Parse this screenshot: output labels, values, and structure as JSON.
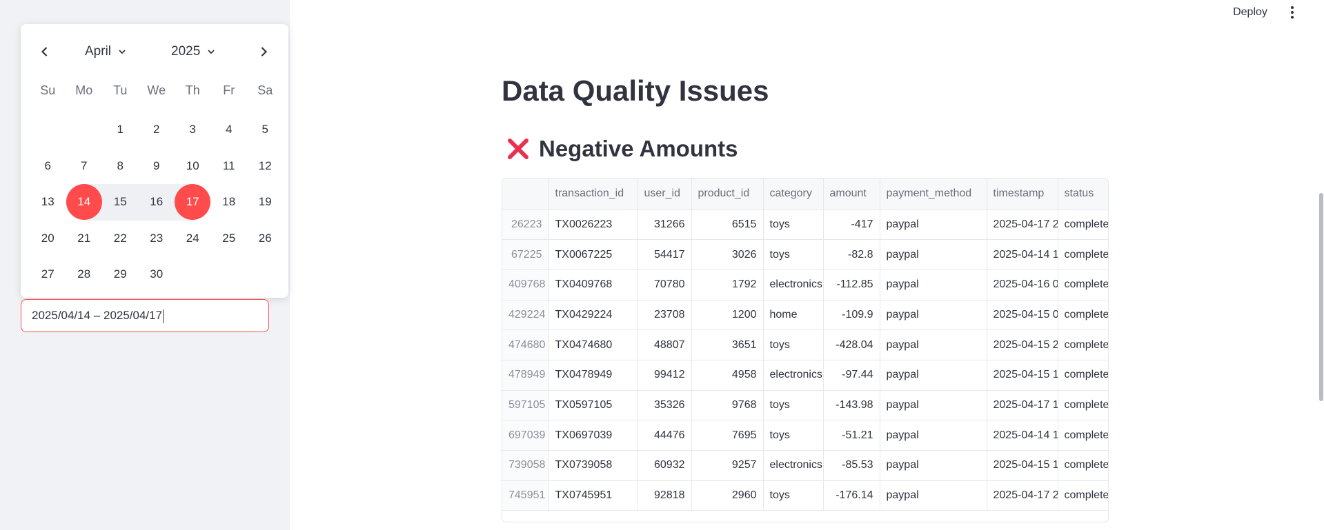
{
  "header": {
    "deploy_label": "Deploy"
  },
  "calendar": {
    "month": "April",
    "year": "2025",
    "weekdays": [
      "Su",
      "Mo",
      "Tu",
      "We",
      "Th",
      "Fr",
      "Sa"
    ],
    "weeks": [
      [
        "",
        "",
        "1",
        "2",
        "3",
        "4",
        "5"
      ],
      [
        "6",
        "7",
        "8",
        "9",
        "10",
        "11",
        "12"
      ],
      [
        "13",
        "14",
        "15",
        "16",
        "17",
        "18",
        "19"
      ],
      [
        "20",
        "21",
        "22",
        "23",
        "24",
        "25",
        "26"
      ],
      [
        "27",
        "28",
        "29",
        "30",
        "",
        "",
        ""
      ]
    ],
    "range_start": "14",
    "range_end": "17",
    "accent_color": "#ff4b4b"
  },
  "date_input": {
    "value": "2025/04/14 – 2025/04/17"
  },
  "main": {
    "title": "Data Quality Issues",
    "section_title": "Negative Amounts",
    "section_icon": "red-x-icon"
  },
  "table": {
    "columns": [
      "",
      "transaction_id",
      "user_id",
      "product_id",
      "category",
      "amount",
      "payment_method",
      "timestamp",
      "status"
    ],
    "rows": [
      [
        "26223",
        "TX0026223",
        "31266",
        "6515",
        "toys",
        "-417",
        "paypal",
        "2025-04-17 2",
        "complete"
      ],
      [
        "67225",
        "TX0067225",
        "54417",
        "3026",
        "toys",
        "-82.8",
        "paypal",
        "2025-04-14 1",
        "complete"
      ],
      [
        "409768",
        "TX0409768",
        "70780",
        "1792",
        "electronics",
        "-112.85",
        "paypal",
        "2025-04-16 0",
        "complete"
      ],
      [
        "429224",
        "TX0429224",
        "23708",
        "1200",
        "home",
        "-109.9",
        "paypal",
        "2025-04-15 0",
        "complete"
      ],
      [
        "474680",
        "TX0474680",
        "48807",
        "3651",
        "toys",
        "-428.04",
        "paypal",
        "2025-04-15 2",
        "complete"
      ],
      [
        "478949",
        "TX0478949",
        "99412",
        "4958",
        "electronics",
        "-97.44",
        "paypal",
        "2025-04-15 1",
        "complete"
      ],
      [
        "597105",
        "TX0597105",
        "35326",
        "9768",
        "toys",
        "-143.98",
        "paypal",
        "2025-04-17 1",
        "complete"
      ],
      [
        "697039",
        "TX0697039",
        "44476",
        "7695",
        "toys",
        "-51.21",
        "paypal",
        "2025-04-14 1",
        "complete"
      ],
      [
        "739058",
        "TX0739058",
        "60932",
        "9257",
        "electronics",
        "-85.53",
        "paypal",
        "2025-04-15 1",
        "complete"
      ],
      [
        "745951",
        "TX0745951",
        "92818",
        "2960",
        "toys",
        "-176.14",
        "paypal",
        "2025-04-17 2",
        "complete"
      ]
    ]
  }
}
